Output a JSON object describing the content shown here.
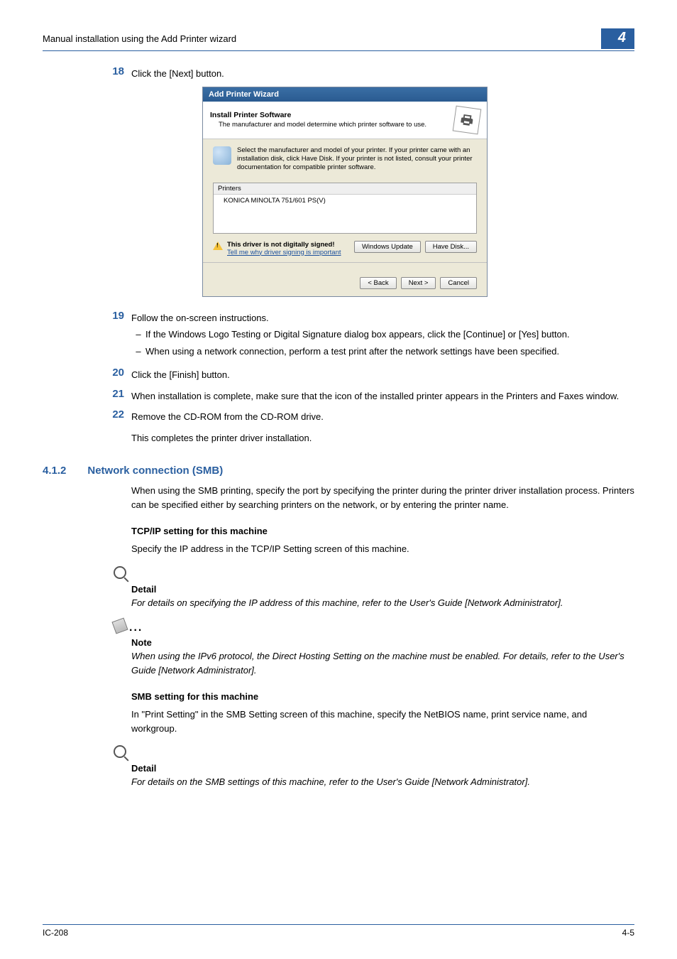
{
  "header": {
    "title": "Manual installation using the Add Printer wizard",
    "chapter": "4"
  },
  "steps": {
    "s18": {
      "num": "18",
      "text": "Click the [Next] button."
    },
    "s19": {
      "num": "19",
      "text": "Follow the on-screen instructions.",
      "b1": "If the Windows Logo Testing or Digital Signature dialog box appears, click the [Continue] or [Yes] button.",
      "b2": "When using a network connection, perform a test print after the network settings have been specified."
    },
    "s20": {
      "num": "20",
      "text": "Click the [Finish] button."
    },
    "s21": {
      "num": "21",
      "text": "When installation is complete, make sure that the icon of the installed printer appears in the Printers and Faxes window."
    },
    "s22": {
      "num": "22",
      "text": "Remove the CD-ROM from the CD-ROM drive."
    },
    "closing": "This completes the printer driver installation."
  },
  "wizard": {
    "title": "Add Printer Wizard",
    "head1": "Install Printer Software",
    "head2": "The manufacturer and model determine which printer software to use.",
    "info": "Select the manufacturer and model of your printer. If your printer came with an installation disk, click Have Disk. If your printer is not listed, consult your printer documentation for compatible printer software.",
    "list_head": "Printers",
    "list_item": "KONICA MINOLTA 751/601 PS(V)",
    "warn_bold": "This driver is not digitally signed!",
    "warn_link": "Tell me why driver signing is important",
    "btn_wu": "Windows Update",
    "btn_hd": "Have Disk...",
    "btn_back": "< Back",
    "btn_next": "Next >",
    "btn_cancel": "Cancel"
  },
  "section": {
    "num": "4.1.2",
    "title": "Network connection (SMB)",
    "intro": "When using the SMB printing, specify the port by specifying the printer during the printer driver installation process. Printers can be specified either by searching printers on the network, or by entering the printer name.",
    "tcp_head": "TCP/IP setting for this machine",
    "tcp_text": "Specify the IP address in the TCP/IP Setting screen of this machine.",
    "detail1_title": "Detail",
    "detail1_body": "For details on specifying the IP address of this machine, refer to the User's Guide [Network Administrator].",
    "note_title": "Note",
    "note_body": "When using the IPv6 protocol, the Direct Hosting Setting on the machine must be enabled. For details, refer to the User's Guide [Network Administrator].",
    "smb_head": "SMB setting for this machine",
    "smb_text": "In \"Print Setting\" in the SMB Setting screen of this machine, specify the NetBIOS name, print service name, and workgroup.",
    "detail2_title": "Detail",
    "detail2_body": "For details on the SMB settings of this machine, refer to the User's Guide [Network Administrator]."
  },
  "footer": {
    "left": "IC-208",
    "right": "4-5"
  }
}
